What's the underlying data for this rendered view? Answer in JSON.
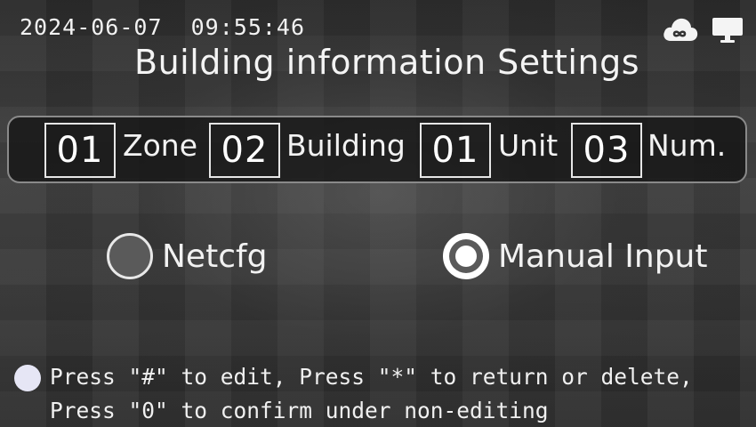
{
  "status_bar": {
    "datetime": "2024-06-07  09:55:46",
    "icons": [
      "cloud-link-icon",
      "monitor-icon"
    ]
  },
  "title": "Building information Settings",
  "address": {
    "zone": {
      "value": "01",
      "label": "Zone"
    },
    "building": {
      "value": "02",
      "label": "Building"
    },
    "unit": {
      "value": "01",
      "label": "Unit"
    },
    "num": {
      "value": "03",
      "label": "Num."
    }
  },
  "mode": {
    "options": [
      {
        "label": "Netcfg",
        "selected": false
      },
      {
        "label": "Manual Input",
        "selected": true
      }
    ]
  },
  "hint": {
    "line1": "Press \"#\" to edit, Press \"*\" to return or delete,",
    "line2": "Press \"0\" to confirm under non-editing"
  },
  "colors": {
    "text": "#f0f0f0",
    "bar_border": "#8a8a8a",
    "bar_fill": "#141414"
  }
}
